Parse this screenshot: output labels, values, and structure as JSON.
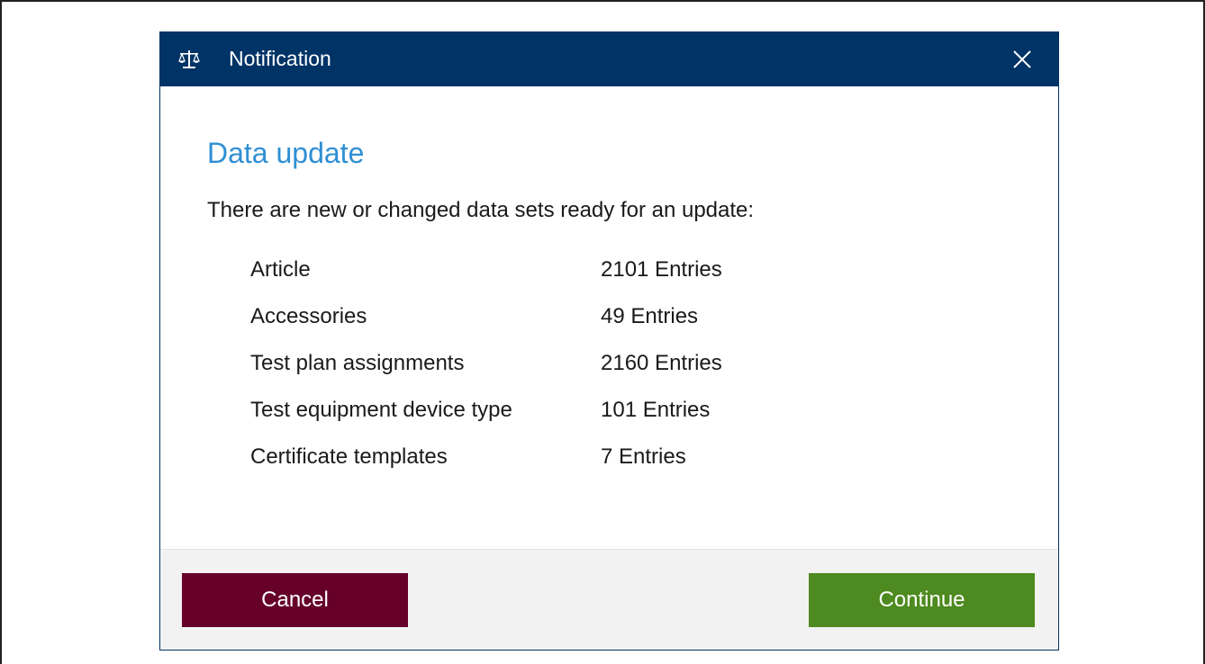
{
  "window": {
    "title": "Notification",
    "app_icon": "scales-icon",
    "close_icon": "close-icon"
  },
  "dialog": {
    "heading": "Data update",
    "intro": "There are new or changed data sets ready for an update:",
    "datasets": [
      {
        "name": "Article",
        "count": "2101 Entries"
      },
      {
        "name": "Accessories",
        "count": "49 Entries"
      },
      {
        "name": "Test plan assignments",
        "count": "2160 Entries"
      },
      {
        "name": "Test equipment device type",
        "count": "101 Entries"
      },
      {
        "name": "Certificate templates",
        "count": "7 Entries"
      }
    ]
  },
  "footer": {
    "cancel_label": "Cancel",
    "continue_label": "Continue"
  },
  "colors": {
    "titlebar": "#003366",
    "heading": "#2f8fd4",
    "cancel_button": "#66002b",
    "continue_button": "#4d8a1f",
    "footer_background": "#f2f2f2"
  }
}
